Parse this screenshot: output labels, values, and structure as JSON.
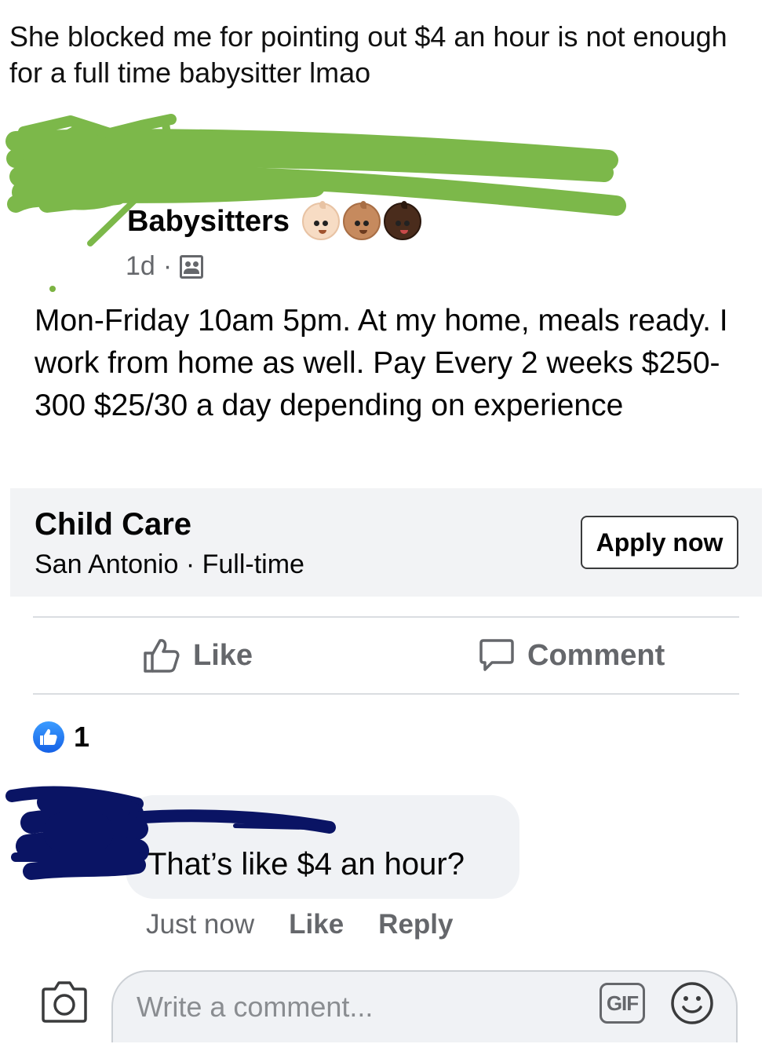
{
  "caption": "She blocked me for pointing out $4 an hour is not enough for a full time babysitter lmao",
  "post": {
    "group_name": "Babysitters",
    "time": "1d",
    "separator": "·",
    "body": "Mon-Friday 10am 5pm. At my home, meals ready. I work from home as well. Pay Every 2 weeks $250-300 $25/30 a day depending on experience",
    "icons": [
      "baby-light-skin-emoji",
      "baby-medium-skin-emoji",
      "baby-dark-skin-emoji",
      "group-privacy-icon"
    ]
  },
  "job": {
    "title": "Child Care",
    "subtitle": "San Antonio · Full-time",
    "apply_label": "Apply now"
  },
  "actions": {
    "like_label": "Like",
    "comment_label": "Comment"
  },
  "reactions": {
    "count": "1"
  },
  "comment": {
    "text": "That’s like $4 an hour?",
    "time": "Just now",
    "like_label": "Like",
    "reply_label": "Reply"
  },
  "composer": {
    "placeholder": "Write a comment...",
    "gif_label": "GIF",
    "icons": [
      "camera-icon",
      "emoji-icon"
    ]
  },
  "colors": {
    "scribble_green": "#7cb84a",
    "scribble_navy": "#0a1464",
    "muted_text": "#65676b",
    "card_bg": "#f2f3f5",
    "like_blue": "#1877f2"
  }
}
